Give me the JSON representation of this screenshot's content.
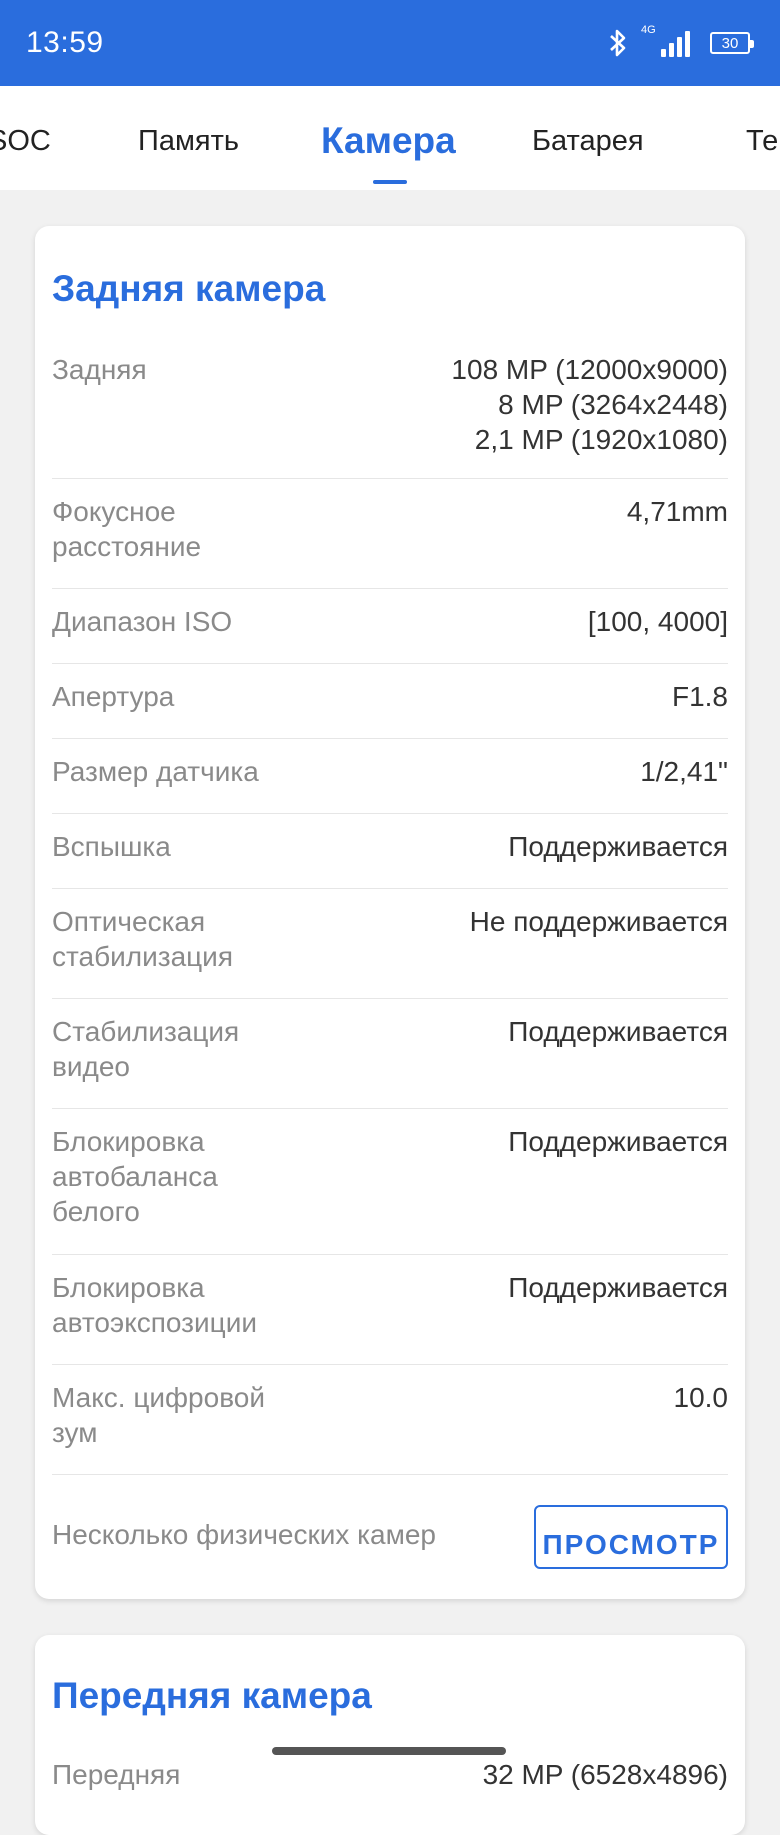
{
  "status_bar": {
    "time": "13:59",
    "network": "4G",
    "battery": "30"
  },
  "tabs": [
    {
      "label": "SOC"
    },
    {
      "label": "Память"
    },
    {
      "label": "Камера"
    },
    {
      "label": "Батарея"
    },
    {
      "label": "Те"
    }
  ],
  "rear_camera": {
    "title": "Задняя камера",
    "rows": [
      {
        "label": "Задняя",
        "value": "108 MP (12000x9000)\n8 MP (3264x2448)\n2,1 MP (1920x1080)"
      },
      {
        "label": "Фокусное расстояние",
        "value": "4,71mm"
      },
      {
        "label": "Диапазон ISO",
        "value": "[100, 4000]"
      },
      {
        "label": "Апертура",
        "value": "F1.8"
      },
      {
        "label": "Размер датчика",
        "value": "1/2,41\""
      },
      {
        "label": "Вспышка",
        "value": "Поддерживается"
      },
      {
        "label": "Оптическая стабилизация",
        "value": "Не поддерживается"
      },
      {
        "label": "Стабилизация видео",
        "value": "Поддерживается"
      },
      {
        "label": "Блокировка автобаланса белого",
        "value": "Поддерживается"
      },
      {
        "label": "Блокировка автоэкспозиции",
        "value": "Поддерживается"
      },
      {
        "label": "Макс. цифровой зум",
        "value": "10.0"
      },
      {
        "label": "Несколько физических камер",
        "value": ""
      }
    ],
    "view_button": "ПРОСМОТР"
  },
  "front_camera": {
    "title": "Передняя камера",
    "row": {
      "label": "Передняя",
      "value": "32 MP (6528x4896)"
    }
  }
}
